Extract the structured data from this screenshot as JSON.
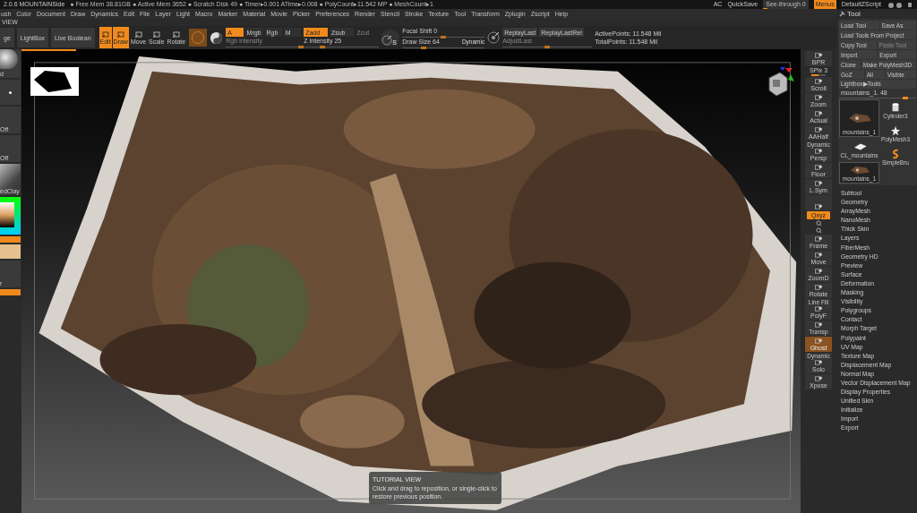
{
  "status_bar": {
    "title": "2.0.6 MOUNTAINSide",
    "stats": "● Free Mem 38.81GB ● Active Mem 3652 ● Scratch Disk 49 ● Timer▸0.001 ATime▸0.008 ● PolyCount▸11.542 MP ● MeshCount▸1",
    "right_items": [
      {
        "label": "AC",
        "kind": "text"
      },
      {
        "label": "QuickSave",
        "kind": "text"
      },
      {
        "label": "See-through 0",
        "kind": "slider",
        "level": 0.1
      },
      {
        "label": "Menus",
        "kind": "toggle",
        "selected": true
      },
      {
        "label": "DefaultZScript",
        "kind": "text"
      }
    ]
  },
  "menu_bar": [
    "ush",
    "Color",
    "Document",
    "Draw",
    "Dynamics",
    "Edit",
    "File",
    "Layer",
    "Light",
    "Macro",
    "Marker",
    "Material",
    "Movie",
    "Picker",
    "Preferences",
    "Render",
    "Stencil",
    "Stroke",
    "Texture",
    "Tool",
    "Transform",
    "Zplugin",
    "Zscript",
    "Help"
  ],
  "view_label": "VIEW",
  "toolbar": {
    "left_buttons": [
      "ge",
      "LightBox",
      "Live Boolean"
    ],
    "transform_buttons": [
      {
        "label": "Edit",
        "selected": true
      },
      {
        "label": "Draw",
        "selected": true
      },
      {
        "label": "Move",
        "selected": false
      },
      {
        "label": "Scale",
        "selected": false
      },
      {
        "label": "Rotate",
        "selected": false
      }
    ],
    "color_modes": [
      {
        "label": "A",
        "selected": true
      },
      {
        "label": "Mrgb",
        "selected": false
      },
      {
        "label": "Rgb",
        "selected": false
      },
      {
        "label": "M",
        "selected": false
      }
    ],
    "rgb_intensity": {
      "label": "Rgb Intensity",
      "disabled": true,
      "level": 1
    },
    "z_modes": [
      {
        "label": "Zadd",
        "selected": true,
        "disabled": false
      },
      {
        "label": "Zsub",
        "selected": false,
        "disabled": false
      },
      {
        "label": "Zcut",
        "selected": false,
        "disabled": true
      }
    ],
    "z_intensity": {
      "label": "Z Intensity 25",
      "level": 0.25
    },
    "stroke_badge": "S",
    "focal_shift": {
      "label": "Focal Shift 0",
      "level": 0.5
    },
    "draw_size": {
      "label": "Draw Size 64",
      "level": 0.26
    },
    "dynamic": "Dynamic",
    "replay": [
      {
        "label": "ReplayLast",
        "disabled": false
      },
      {
        "label": "ReplayLastRel",
        "disabled": false
      }
    ],
    "adjust_last": {
      "label": "AdjustLast",
      "disabled": true,
      "level": 0.5
    },
    "points": [
      "ActivePoints: 11.548 Mil",
      "TotalPoints: 11.548 Mil"
    ]
  },
  "left_shelf": [
    {
      "kind": "brush",
      "label": "d"
    },
    {
      "kind": "stroke"
    },
    {
      "kind": "slot",
      "label": "Off"
    },
    {
      "kind": "slot",
      "label": "Off"
    },
    {
      "kind": "material",
      "label": "edClay"
    },
    {
      "kind": "color"
    },
    {
      "kind": "swatch",
      "color": "#f08a1c"
    },
    {
      "kind": "swatch",
      "color": "#e4c18f"
    },
    {
      "kind": "slot",
      "label": "r"
    },
    {
      "kind": "swatch",
      "color": "#f08a1c"
    }
  ],
  "progress": {
    "level": 0.07
  },
  "tutorial": {
    "title": "TUTORIAL VIEW",
    "text": "Click and drag to reposition, or single-click to restore previous position."
  },
  "right_shelf": [
    {
      "kind": "button",
      "label": "BPR",
      "selected": false
    },
    {
      "kind": "slider",
      "label": "SPix 3",
      "level": 0.5
    },
    {
      "kind": "button",
      "label": "Scroll",
      "selected": false
    },
    {
      "kind": "button",
      "label": "Zoom",
      "selected": false
    },
    {
      "kind": "button",
      "label": "Actual",
      "selected": false
    },
    {
      "kind": "button",
      "label": "AAHalf",
      "selected": false
    },
    {
      "kind": "button",
      "label": "Persp",
      "top": "Dynamic",
      "selected": false
    },
    {
      "kind": "button",
      "label": "Floor",
      "selected": false
    },
    {
      "kind": "button",
      "label": "L.Sym",
      "selected": false
    },
    {
      "kind": "button",
      "selected": false
    },
    {
      "kind": "toggle",
      "label": "Qxyz",
      "selected": true
    },
    {
      "kind": "small"
    },
    {
      "kind": "small"
    },
    {
      "kind": "button",
      "label": "Frame",
      "selected": false
    },
    {
      "kind": "button",
      "label": "Move",
      "selected": false
    },
    {
      "kind": "button",
      "label": "ZoomD",
      "selected": false
    },
    {
      "kind": "button",
      "label": "Rotate",
      "selected": false
    },
    {
      "kind": "button",
      "label": "PolyF",
      "top": "Line Fill",
      "selected": false
    },
    {
      "kind": "button",
      "label": "Transp",
      "selected": false
    },
    {
      "kind": "button",
      "label": "Ghost",
      "selected": true
    },
    {
      "kind": "button",
      "label": "Solo",
      "top": "Dynamic",
      "selected": false
    },
    {
      "kind": "button",
      "label": "Xpose",
      "selected": false
    }
  ],
  "tool_palette": {
    "title": "Tool",
    "button_rows": [
      [
        {
          "label": "Load Tool",
          "disabled": false
        },
        {
          "label": "Save As",
          "disabled": false
        }
      ],
      [
        {
          "label": "Load Tools From Project",
          "disabled": false
        }
      ],
      [
        {
          "label": "Copy Tool",
          "disabled": false
        },
        {
          "label": "Paste Tool",
          "disabled": true
        }
      ],
      [
        {
          "label": "Import",
          "disabled": false
        },
        {
          "label": "Export",
          "disabled": false
        }
      ],
      [
        {
          "label": "Clone",
          "disabled": false
        },
        {
          "label": "Make PolyMesh3D",
          "disabled": false
        }
      ],
      [
        {
          "label": "GoZ",
          "disabled": false
        },
        {
          "label": "All",
          "disabled": false
        },
        {
          "label": "Visible",
          "disabled": false
        }
      ],
      [
        {
          "label": "Lightbox▶Tools",
          "disabled": false
        }
      ]
    ],
    "tool_slider": {
      "label": "mountains_1. 48",
      "level": 0.9
    },
    "thumbs_left": [
      {
        "label": "mountains_1",
        "kind": "terrain",
        "selected": true,
        "big": true
      },
      {
        "label": "CL_mountains",
        "kind": "cloth",
        "selected": false,
        "big": false
      },
      {
        "label": "mountains_1",
        "kind": "terrain",
        "selected": true,
        "big": false
      }
    ],
    "thumbs_right": [
      {
        "label": "Cylinder3",
        "kind": "cylinder",
        "selected": false
      },
      {
        "label": "PolyMesh3",
        "kind": "star",
        "selected": false
      },
      {
        "label": "SimpleBru",
        "kind": "brush",
        "selected": false
      }
    ],
    "subpalettes": [
      "Subtool",
      "Geometry",
      "ArrayMesh",
      "NanoMesh",
      "Thick Skin",
      "Layers",
      "FiberMesh",
      "Geometry HD",
      "Preview",
      "Surface",
      "Deformation",
      "Masking",
      "Visibility",
      "Polygroups",
      "Contact",
      "Morph Target",
      "Polypaint",
      "UV Map",
      "Texture Map",
      "Displacement Map",
      "Normal Map",
      "Vector Displacement Map",
      "Display Properties",
      "Unified Skin",
      "Initialize",
      "Import",
      "Export"
    ]
  }
}
